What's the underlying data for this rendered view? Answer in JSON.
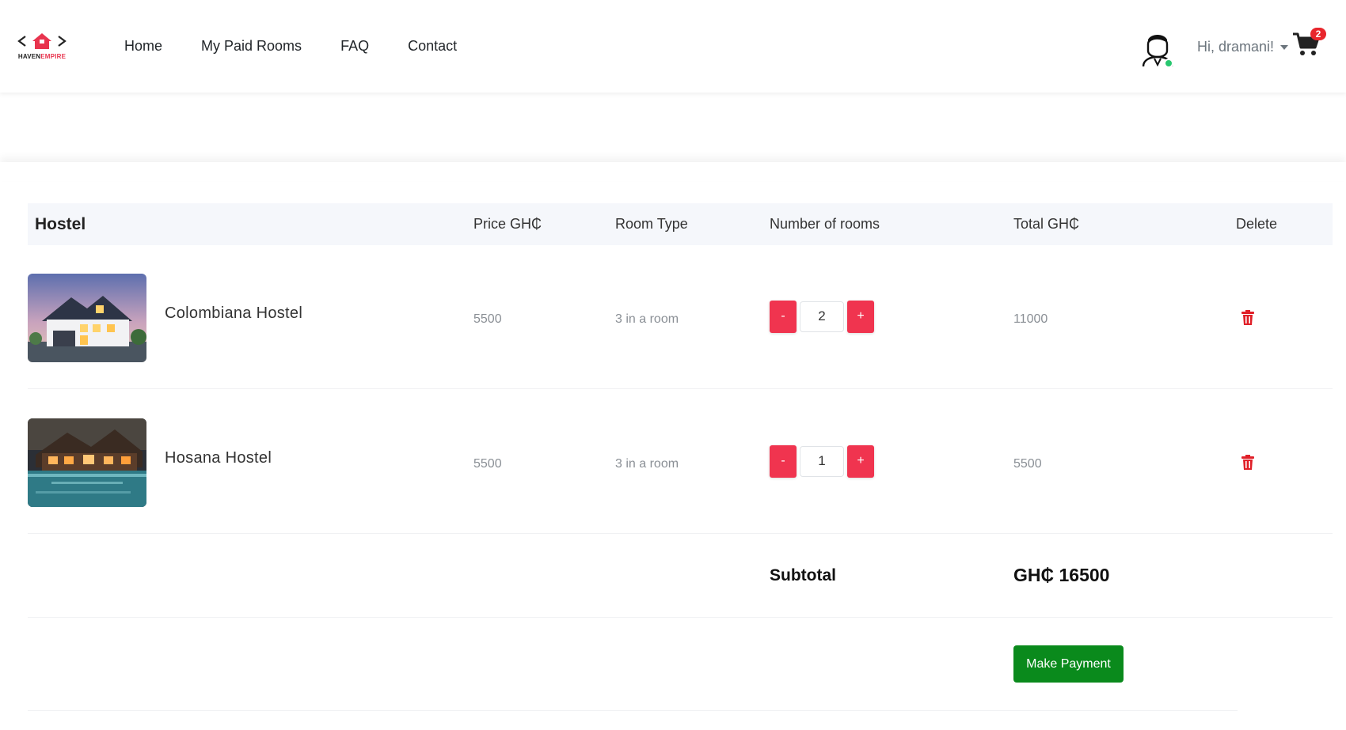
{
  "brand": {
    "logo_word_1": "HAVEN",
    "logo_word_2": "EMPIRE",
    "accent_color": "#e8344e"
  },
  "nav": {
    "links": [
      {
        "label": "Home"
      },
      {
        "label": "My Paid Rooms"
      },
      {
        "label": "FAQ"
      },
      {
        "label": "Contact"
      }
    ]
  },
  "user": {
    "greeting": "Hi, dramani!",
    "online_status_color": "#28c76f",
    "avatar_icon": "user-avatar-icon"
  },
  "cart": {
    "count": "2",
    "icon": "shopping-cart-icon"
  },
  "table": {
    "headers": {
      "hostel": "Hostel",
      "price": "Price GH₵",
      "room_type": "Room Type",
      "num_rooms": "Number of rooms",
      "total": "Total GH₵",
      "delete": "Delete"
    },
    "rows": [
      {
        "name": "Colombiana Hostel",
        "price": "5500",
        "room_type": "3 in a room",
        "quantity": "2",
        "total": "11000",
        "thumbnail": "house-at-dusk-image"
      },
      {
        "name": "Hosana Hostel",
        "price": "5500",
        "room_type": "3 in a room",
        "quantity": "1",
        "total": "5500",
        "thumbnail": "lodge-with-pool-image"
      }
    ],
    "decrement_label": "-",
    "increment_label": "+",
    "delete_icon": "trash-icon"
  },
  "summary": {
    "subtotal_label": "Subtotal",
    "subtotal_value": "GH₵ 16500"
  },
  "actions": {
    "make_payment_label": "Make Payment",
    "payment_color": "#0a8a1c",
    "quantity_button_color": "#f0344f"
  }
}
